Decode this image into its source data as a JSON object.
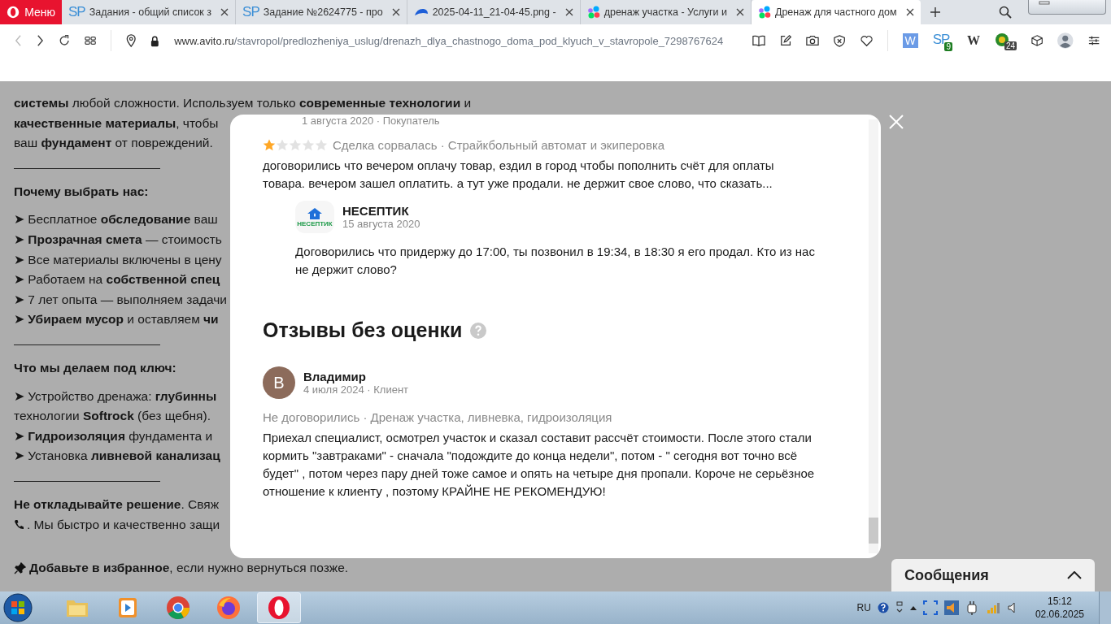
{
  "browser": {
    "menu_label": "Меню",
    "tabs": [
      {
        "title": "Задания - общий список з",
        "kind": "sp",
        "logo_text": "SP",
        "selected": false
      },
      {
        "title": "Задание №2624775 - про",
        "kind": "sp",
        "logo_text": "SP",
        "selected": false
      },
      {
        "title": "2025-04-11_21-04-45.png -",
        "kind": "cloud",
        "selected": false
      },
      {
        "title": "дренаж участка - Услуги и",
        "kind": "dots",
        "selected": false
      },
      {
        "title": "Дренаж для частного дом",
        "kind": "dots",
        "selected": true
      }
    ],
    "url_domain": "www.avito.ru",
    "url_path": "/stavropol/predlozheniya_uslug/drenazh_dlya_chastnogo_doma_pod_klyuch_v_stavropole_7298767624",
    "extensions": [
      {
        "kind": "w",
        "label": "W"
      },
      {
        "kind": "sp",
        "label": "SP",
        "badge": "9"
      },
      {
        "kind": "wiki",
        "label": "W"
      },
      {
        "kind": "round",
        "badge": "24"
      },
      {
        "kind": "cube"
      }
    ]
  },
  "page": {
    "lines": [
      {
        "kind": "text",
        "text": "**системы** любой сложности. Используем только **современные технологии** и"
      },
      {
        "kind": "text",
        "text": "**качественные материалы**, чтобы"
      },
      {
        "kind": "text",
        "text": "ваш **фундамент** от повреждений."
      },
      {
        "kind": "rule"
      },
      {
        "kind": "heading",
        "text": "Почему выбрать нас:"
      },
      {
        "kind": "text",
        "text": "➤ Бесплатное **обследование** ваш"
      },
      {
        "kind": "text",
        "text": "➤ **Прозрачная смета** — стоимость"
      },
      {
        "kind": "text",
        "text": "➤ Все материалы включены в цену"
      },
      {
        "kind": "text",
        "text": "➤ Работаем на **собственной спец**"
      },
      {
        "kind": "text",
        "text": "➤ 7 лет опыта — выполняем задачи"
      },
      {
        "kind": "text",
        "text": "➤ **Убираем мусор** и оставляем **чи**"
      },
      {
        "kind": "rule"
      },
      {
        "kind": "heading",
        "text": "Что мы делаем под ключ:"
      },
      {
        "kind": "text",
        "text": "➤ Устройство дренажа: **глубинны**"
      },
      {
        "kind": "text",
        "text": "технологии **Softrock** (без щебня)."
      },
      {
        "kind": "text",
        "text": "➤ **Гидроизоляция** фундамента и"
      },
      {
        "kind": "text",
        "text": "➤ Установка **ливневой канализац**"
      },
      {
        "kind": "rule"
      },
      {
        "kind": "text",
        "text": "**Не откладывайте решение**. Свяж"
      },
      {
        "kind": "phone",
        "text": ". Мы быстро и качественно защи"
      },
      {
        "kind": "pin",
        "text": "**Добавьте в избранное**, если нужно вернуться позже."
      }
    ]
  },
  "modal": {
    "reviews": [
      {
        "date_role": "1 августа 2020 · Покупатель",
        "stars": 1,
        "deal": "Сделка сорвалась · Страйкбольный автомат и экиперовка",
        "text": "договорились что вечером оплачу товар, ездил в город чтобы пополнить счёт для оплаты товара. вечером зашел оплатить. а тут уже продали. не держит свое слово, что сказать...",
        "reply": {
          "logo_text": "НЕСЕПТИК",
          "name": "НЕСЕПТИК",
          "date": "15 августа 2020",
          "text": "Договорились что придержу до 17:00, ты позвонил в 19:34, в 18:30 я его продал. Кто из нас не держит слово?"
        }
      }
    ],
    "unrated_heading": "Отзывы без оценки",
    "unrated": [
      {
        "initial": "В",
        "name": "Владимир",
        "date_role": "4 июля 2024 · Клиент",
        "deal": "Не договорились · Дренаж участка, ливневка, гидроизоляция",
        "text": "Приехал специалист, осмотрел участок и сказал составит рассчёт стоимости. После этого стали кормить \"завтраками\" - сначала \"подождите до конца недели\", потом - \" сегодня вот точно всё будет\" , потом через пару дней тоже самое и опять на четыре дня пропали. Короче не серьёзное отношение к клиенту , поэтому КРАЙНЕ НЕ РЕКОМЕНДУЮ!"
      }
    ]
  },
  "messages_panel": {
    "title": "Сообщения"
  },
  "taskbar": {
    "apps": [
      {
        "kind": "explorer",
        "selected": false
      },
      {
        "kind": "media",
        "selected": false
      },
      {
        "kind": "chrome",
        "selected": false
      },
      {
        "kind": "firefox",
        "selected": false
      },
      {
        "kind": "opera",
        "selected": true
      }
    ],
    "language": "RU",
    "time": "15:12",
    "date": "02.06.2025"
  }
}
